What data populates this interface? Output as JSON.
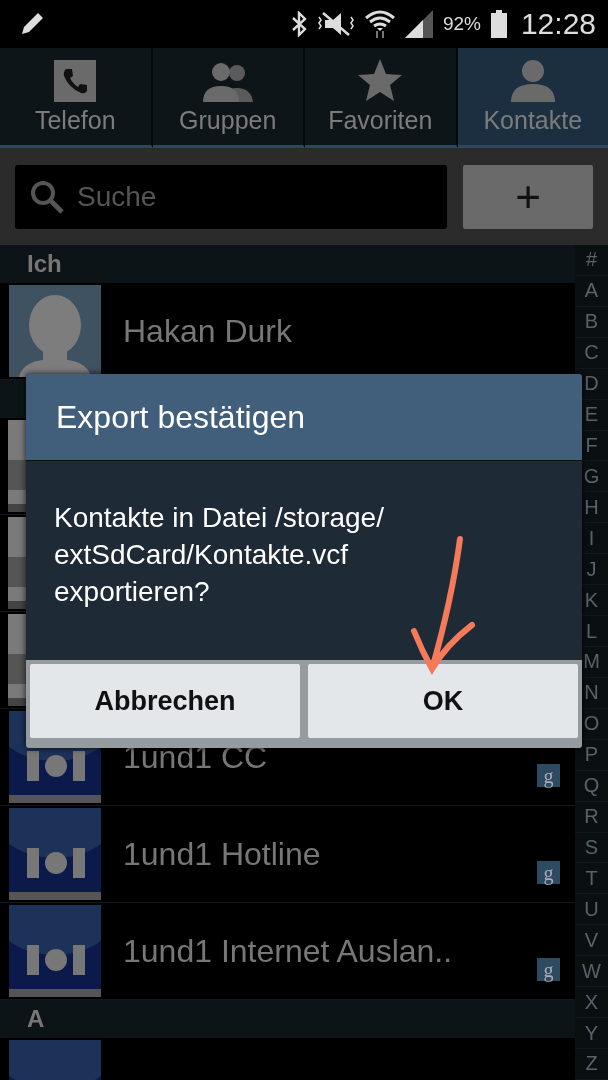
{
  "status_bar": {
    "battery_text": "92%",
    "time": "12:28"
  },
  "tabs": [
    {
      "label": "Telefon",
      "selected": false
    },
    {
      "label": "Gruppen",
      "selected": false
    },
    {
      "label": "Favoriten",
      "selected": false
    },
    {
      "label": "Kontakte",
      "selected": true
    }
  ],
  "search": {
    "placeholder": "Suche",
    "add_button": "+"
  },
  "contacts": [
    {
      "kind": "header",
      "label": "Ich"
    },
    {
      "kind": "me",
      "name": "Hakan Durk"
    },
    {
      "kind": "header"
    },
    {
      "kind": "covered"
    },
    {
      "kind": "covered"
    },
    {
      "kind": "covered"
    },
    {
      "kind": "contact",
      "name": "1und1 CC",
      "badge": "g"
    },
    {
      "kind": "contact",
      "name": "1und1 Hotline",
      "badge": "g"
    },
    {
      "kind": "contact",
      "name": "1und1 Internet Auslan..",
      "badge": "g"
    },
    {
      "kind": "header",
      "label": "A"
    },
    {
      "kind": "contact"
    }
  ],
  "index": [
    "#",
    "A",
    "B",
    "C",
    "D",
    "E",
    "F",
    "G",
    "H",
    "I",
    "J",
    "K",
    "L",
    "M",
    "N",
    "O",
    "P",
    "Q",
    "R",
    "S",
    "T",
    "U",
    "V",
    "W",
    "X",
    "Y",
    "Z"
  ],
  "dialog": {
    "title": "Export bestätigen",
    "message": "Kontakte in Datei /storage/ extSdCard/Kontakte.vcf exportieren?",
    "buttons": [
      "Abbrechen",
      "OK"
    ]
  }
}
